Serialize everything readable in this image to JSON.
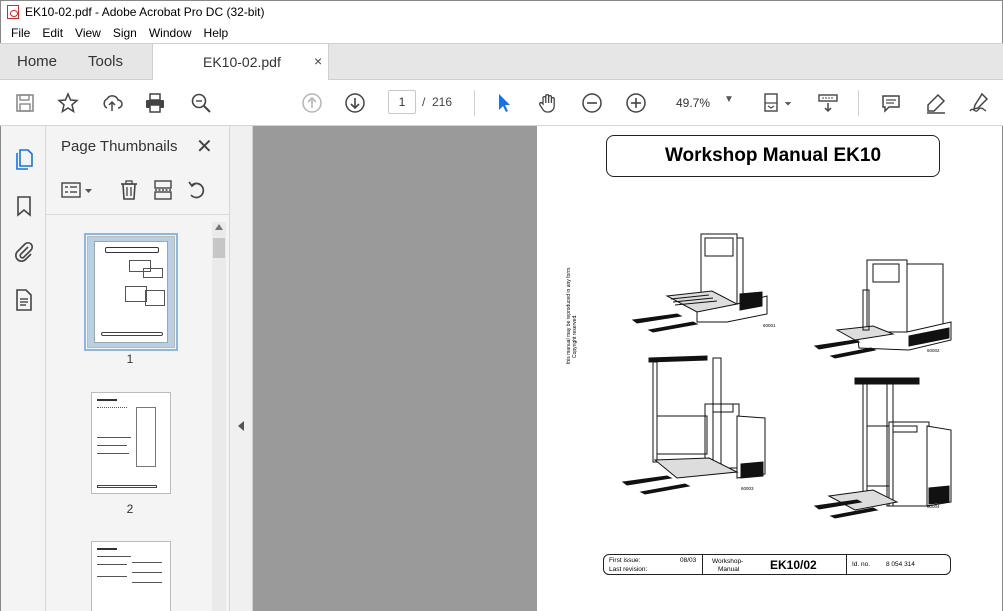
{
  "window": {
    "title": "EK10-02.pdf - Adobe Acrobat Pro DC (32-bit)"
  },
  "menu": {
    "items": [
      "File",
      "Edit",
      "View",
      "Sign",
      "Window",
      "Help"
    ]
  },
  "tabs": {
    "home": "Home",
    "tools": "Tools",
    "document": "EK10-02.pdf",
    "close_glyph": "×"
  },
  "toolbar": {
    "current_page": "1",
    "page_separator": "/",
    "total_pages": "216",
    "zoom": "49.7%",
    "icons": [
      "save-icon",
      "bookmark-star-icon",
      "upload-icon",
      "print-icon",
      "find-zoom-icon",
      "previous-page-icon",
      "next-page-icon",
      "select-cursor-icon",
      "hand-icon",
      "zoom-out-icon",
      "zoom-in-icon",
      "page-fit-icon",
      "scroll-mode-icon",
      "comment-icon",
      "highlight-icon",
      "sign-icon"
    ]
  },
  "left_rail": {
    "icons": [
      "page-thumbnails-icon",
      "bookmarks-icon",
      "attachments-icon",
      "document-properties-icon"
    ]
  },
  "thumbnail_panel": {
    "title": "Page Thumbnails",
    "close_glyph": "✕",
    "thumbnails": [
      {
        "label": "1",
        "selected": true
      },
      {
        "label": "2",
        "selected": false
      },
      {
        "label": "",
        "selected": false
      }
    ]
  },
  "page": {
    "title": "Workshop Manual EK10",
    "side_note_line1": "this manual may be reproduced in any form.",
    "side_note_line2": "Copyright reserved.",
    "figure_codes": [
      "60001",
      "60002",
      "60003",
      "60004"
    ],
    "footer": {
      "first_issue_label": "First issue:",
      "first_issue_value": "08/03",
      "last_revision_label": "Last revision:",
      "manual_type_line1": "Workshop-",
      "manual_type_line2": "Manual",
      "model": "EK10/02",
      "id_label": "Id. no.",
      "id_value": "8 054 314"
    }
  },
  "colors": {
    "accent_blue": "#1473e6",
    "viewer_background": "#9a9a9a",
    "panel_background": "#f4f4f4"
  }
}
